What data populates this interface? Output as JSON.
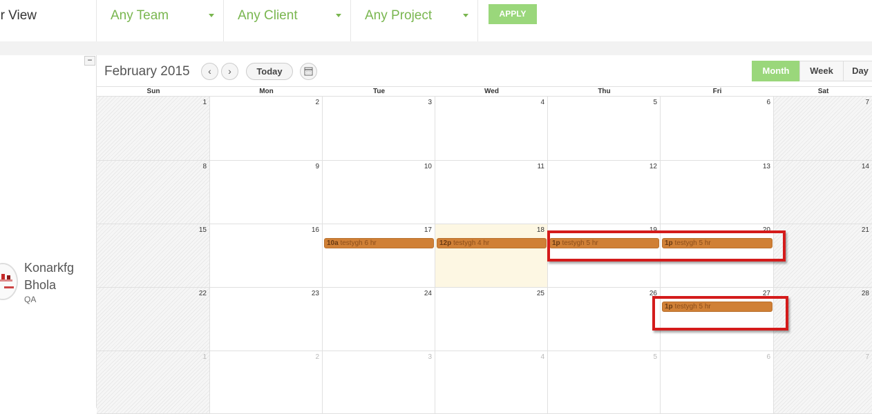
{
  "header": {
    "view_title": "er View",
    "filters": [
      {
        "label": "Any Team"
      },
      {
        "label": "Any Client"
      },
      {
        "label": "Any Project"
      }
    ],
    "apply_label": "APPLY"
  },
  "sidebar": {
    "collapse_label": "−",
    "user": {
      "name": "Konarkfg Bhola",
      "role": "QA"
    }
  },
  "calendar": {
    "title": "February 2015",
    "prev_label": "‹",
    "next_label": "›",
    "today_label": "Today",
    "views": [
      "Month",
      "Week",
      "Day"
    ],
    "active_view": "Month",
    "day_names": [
      "Sun",
      "Mon",
      "Tue",
      "Wed",
      "Thu",
      "Fri",
      "Sat"
    ],
    "weeks": [
      [
        "1",
        "2",
        "3",
        "4",
        "5",
        "6",
        "7"
      ],
      [
        "8",
        "9",
        "10",
        "11",
        "12",
        "13",
        "14"
      ],
      [
        "15",
        "16",
        "17",
        "18",
        "19",
        "20",
        "21"
      ],
      [
        "22",
        "23",
        "24",
        "25",
        "26",
        "27",
        "28"
      ],
      [
        "1",
        "2",
        "3",
        "4",
        "5",
        "6",
        "7"
      ]
    ],
    "today": {
      "week": 2,
      "day": 3
    },
    "events": [
      {
        "week": 2,
        "day": 2,
        "time": "10a",
        "title": "testygh 6 hr"
      },
      {
        "week": 2,
        "day": 3,
        "time": "12p",
        "title": "testygh 4 hr"
      },
      {
        "week": 2,
        "day": 4,
        "time": "1p",
        "title": "testygh 5 hr"
      },
      {
        "week": 2,
        "day": 5,
        "time": "1p",
        "title": "testygh 5 hr"
      },
      {
        "week": 3,
        "day": 5,
        "time": "1p",
        "title": "testygh 5 hr"
      }
    ],
    "colors": {
      "event": "#d08036",
      "accent": "#9ad77b",
      "highlight": "#d41b1b"
    }
  }
}
